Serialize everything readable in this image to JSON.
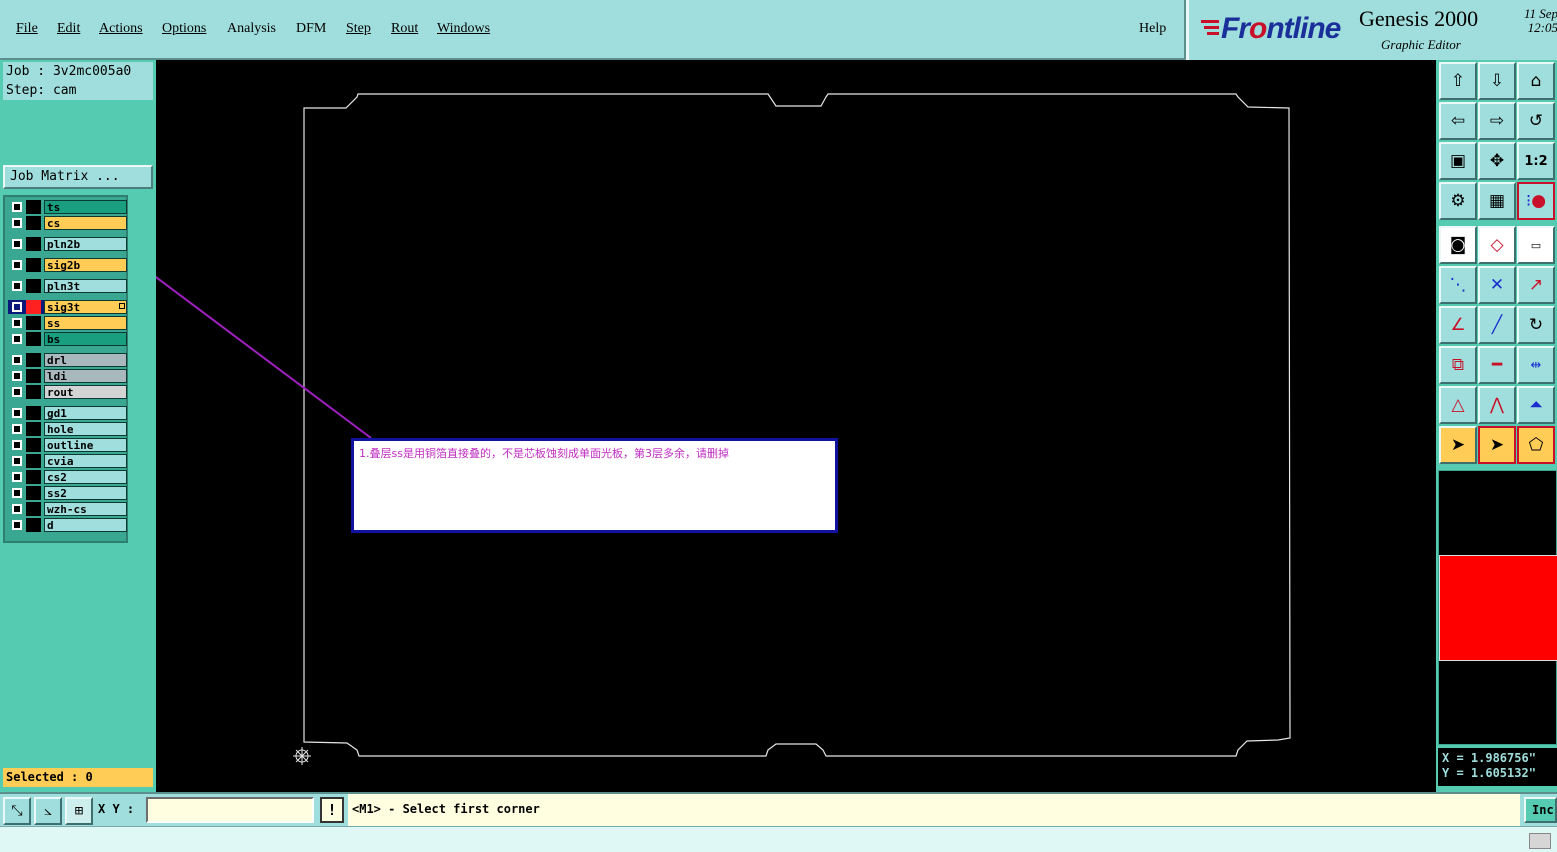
{
  "menu": {
    "items": [
      {
        "label": "File",
        "underline": "F"
      },
      {
        "label": "Edit",
        "underline": "E"
      },
      {
        "label": "Actions",
        "underline": "A"
      },
      {
        "label": "Options",
        "underline": "O"
      },
      {
        "label": "Analysis",
        "underline": ""
      },
      {
        "label": "DFM",
        "underline": ""
      },
      {
        "label": "Step",
        "underline": "S"
      },
      {
        "label": "Rout",
        "underline": "R"
      },
      {
        "label": "Windows",
        "underline": "W"
      }
    ],
    "help": "Help"
  },
  "brand": {
    "logo_prefix": "Fr",
    "logo_o": "o",
    "logo_suffix": "ntline",
    "product": "Genesis 2000",
    "subtitle": "Graphic Editor",
    "date": "11 Sep",
    "time": "12:05"
  },
  "left": {
    "job": "Job : 3v2mc005a0",
    "step": "Step: cam",
    "job_matrix": "Job Matrix ...",
    "selected": "Selected : 0",
    "layers": [
      {
        "name": "ts",
        "color": "#1a9e80"
      },
      {
        "name": "cs",
        "color": "#ffcc55"
      },
      {
        "name": "pln2b",
        "color": "#9fdedc"
      },
      {
        "name": "sig2b",
        "color": "#ffcc55"
      },
      {
        "name": "pln3t",
        "color": "#9fdedc"
      },
      {
        "name": "sig3t",
        "color": "#ffcc55",
        "active": true
      },
      {
        "name": "ss",
        "color": "#ffcc55"
      },
      {
        "name": "bs",
        "color": "#1a9e80"
      },
      {
        "name": "drl",
        "color": "#a9b8bd"
      },
      {
        "name": "ldi",
        "color": "#a9b8bd"
      },
      {
        "name": "rout",
        "color": "#d4d4d4"
      },
      {
        "name": "gd1",
        "color": "#9fdedc"
      },
      {
        "name": "hole",
        "color": "#9fdedc"
      },
      {
        "name": "outline",
        "color": "#9fdedc"
      },
      {
        "name": "cvia",
        "color": "#9fdedc"
      },
      {
        "name": "cs2",
        "color": "#9fdedc"
      },
      {
        "name": "ss2",
        "color": "#9fdedc"
      },
      {
        "name": "wzh-cs",
        "color": "#9fdedc"
      },
      {
        "name": "d",
        "color": "#9fdedc"
      }
    ]
  },
  "canvas": {
    "note": "1.叠层ss是用铜箔直接叠的，不是芯板蚀刻成单面光板，第3层多余，请删掉"
  },
  "coords": {
    "x": "X = 1.986756\"",
    "y": "Y = 1.605132\""
  },
  "bottom": {
    "xy_label": "X Y :",
    "xy_value": "",
    "prompt": "<M1> - Select first corner",
    "inc": "Inc"
  }
}
